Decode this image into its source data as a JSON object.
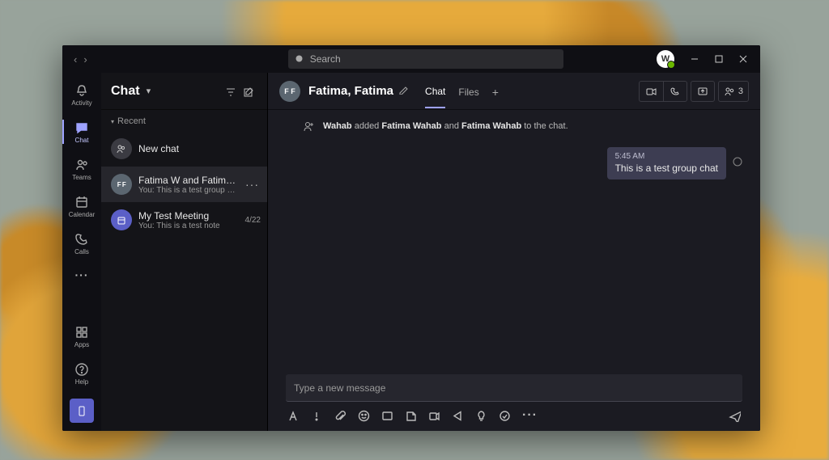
{
  "search": {
    "placeholder": "Search"
  },
  "user": {
    "initial": "W"
  },
  "rail": {
    "activity": "Activity",
    "chat": "Chat",
    "teams": "Teams",
    "calendar": "Calendar",
    "calls": "Calls",
    "apps": "Apps",
    "help": "Help"
  },
  "listHeader": {
    "title": "Chat"
  },
  "recentLabel": "Recent",
  "chats": [
    {
      "title": "New chat",
      "sub": "",
      "date": "",
      "avatarTxt": ""
    },
    {
      "title": "Fatima W and Fatima W",
      "sub": "You: This is a test group chat",
      "date": "",
      "avatarTxt": "F F",
      "active": true
    },
    {
      "title": "My Test Meeting",
      "sub": "You: This is a test note",
      "date": "4/22"
    }
  ],
  "convHeader": {
    "avatar": "F F",
    "title": "Fatima, Fatima",
    "tabs": {
      "chat": "Chat",
      "files": "Files"
    },
    "participantCount": "3"
  },
  "system": {
    "actor": "Wahab",
    "verb": " added ",
    "p1": "Fatima Wahab",
    "and": " and ",
    "p2": "Fatima Wahab",
    "tail": " to the chat."
  },
  "message": {
    "time": "5:45 AM",
    "text": "This is a test group chat"
  },
  "composer": {
    "placeholder": "Type a new message"
  }
}
